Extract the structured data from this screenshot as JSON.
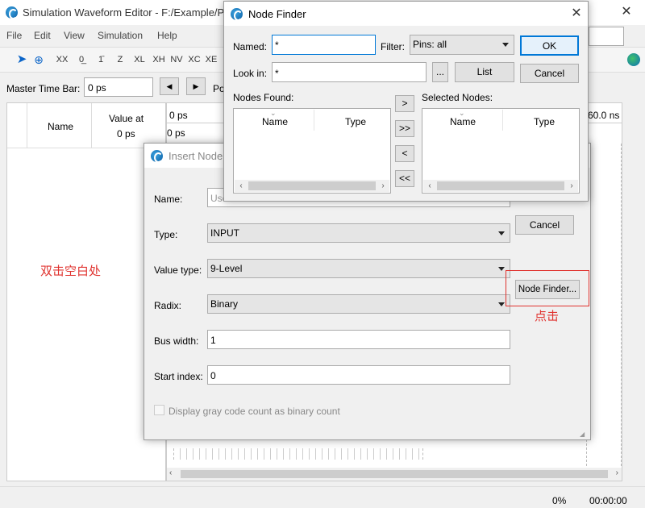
{
  "main_window": {
    "title": "Simulation Waveform Editor - F:/Example/P",
    "menu": [
      "File",
      "Edit",
      "View",
      "Simulation",
      "Help"
    ],
    "master_time_bar_label": "Master Time Bar:",
    "master_time_bar_value": "0 ps",
    "pointer_label": "Po",
    "grid": {
      "name_header": "Name",
      "value_header": "Value at",
      "value_header_sub": "0 ps",
      "timeline_start": "0 ps",
      "timeline_end": "60.0 ns",
      "cursor_label": "0 ps"
    },
    "status_progress": "0%",
    "status_time": "00:00:00",
    "annotation_double_click": "双击空白处"
  },
  "insert_node_dialog": {
    "title": "Insert Node",
    "name_label": "Name:",
    "name_placeholder": "Use",
    "type_label": "Type:",
    "type_value": "INPUT",
    "value_type_label": "Value type:",
    "value_type_value": "9-Level",
    "radix_label": "Radix:",
    "radix_value": "Binary",
    "bus_width_label": "Bus width:",
    "bus_width_value": "1",
    "start_index_label": "Start index:",
    "start_index_value": "0",
    "gray_code_label": "Display gray code count as binary count",
    "cancel_label": "Cancel",
    "node_finder_label": "Node Finder...",
    "annotation_click": "点击"
  },
  "node_finder_dialog": {
    "title": "Node Finder",
    "named_label": "Named:",
    "named_value": "*",
    "filter_label": "Filter:",
    "filter_value": "Pins: all",
    "look_in_label": "Look in:",
    "look_in_value": "*",
    "browse_label": "...",
    "list_label": "List",
    "ok_label": "OK",
    "cancel_label": "Cancel",
    "nodes_found_label": "Nodes Found:",
    "selected_nodes_label": "Selected Nodes:",
    "name_column": "Name",
    "type_column": "Type",
    "move_buttons": [
      ">",
      ">>",
      "<",
      "<<"
    ]
  },
  "colors": {
    "accent": "#0078d7",
    "annotation": "#e0332f"
  }
}
